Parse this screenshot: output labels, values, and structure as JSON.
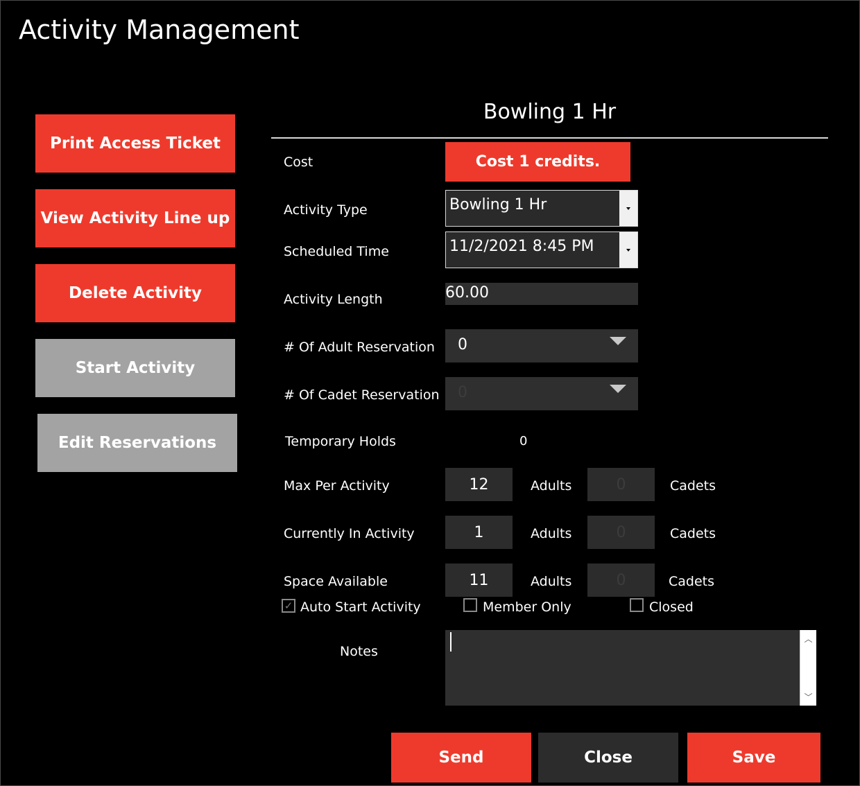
{
  "window": {
    "title": "Activity Management"
  },
  "sidebar": {
    "print_ticket": "Print Access Ticket",
    "view_lineup": "View Activity Line up",
    "delete_activity": "Delete Activity",
    "start_activity": "Start Activity",
    "edit_reservations": "Edit Reservations"
  },
  "form": {
    "heading": "Bowling 1 Hr",
    "cost_label": "Cost",
    "cost_button": "Cost 1 credits.",
    "activity_type_label": "Activity Type",
    "activity_type_value": "Bowling 1 Hr",
    "scheduled_time_label": "Scheduled Time",
    "scheduled_time_value": "11/2/2021 8:45 PM",
    "activity_length_label": "Activity Length",
    "activity_length_value": "60.00",
    "adult_res_label": "# Of Adult Reservation",
    "adult_res_value": "0",
    "cadet_res_label": "# Of Cadet Reservation",
    "cadet_res_value": "0",
    "temp_holds_label": "Temporary Holds",
    "temp_holds_value": "0",
    "max_label": "Max Per Activity",
    "max_adults": "12",
    "max_cadets": "0",
    "current_label": "Currently In Activity",
    "current_adults": "1",
    "current_cadets": "0",
    "space_label": "Space Available",
    "space_adults": "11",
    "space_cadets": "0",
    "adults_word": "Adults",
    "cadets_word": "Cadets",
    "auto_start_label": "Auto Start Activity",
    "auto_start_checked": true,
    "member_only_label": "Member Only",
    "member_only_checked": false,
    "closed_label": "Closed",
    "closed_checked": false,
    "notes_label": "Notes",
    "notes_value": ""
  },
  "footer": {
    "send": "Send",
    "close": "Close",
    "save": "Save"
  },
  "colors": {
    "accent_red": "#ee3a2c",
    "disabled_gray": "#a3a3a3",
    "background": "#000000"
  }
}
